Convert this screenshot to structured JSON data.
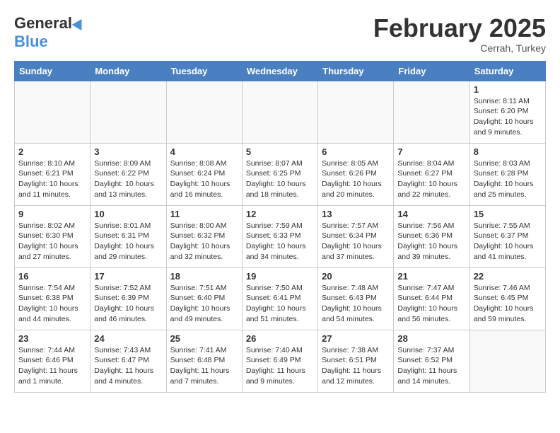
{
  "header": {
    "logo_general": "General",
    "logo_blue": "Blue",
    "month_title": "February 2025",
    "subtitle": "Cerrah, Turkey"
  },
  "weekdays": [
    "Sunday",
    "Monday",
    "Tuesday",
    "Wednesday",
    "Thursday",
    "Friday",
    "Saturday"
  ],
  "weeks": [
    [
      {
        "day": "",
        "info": ""
      },
      {
        "day": "",
        "info": ""
      },
      {
        "day": "",
        "info": ""
      },
      {
        "day": "",
        "info": ""
      },
      {
        "day": "",
        "info": ""
      },
      {
        "day": "",
        "info": ""
      },
      {
        "day": "1",
        "info": "Sunrise: 8:11 AM\nSunset: 6:20 PM\nDaylight: 10 hours\nand 9 minutes."
      }
    ],
    [
      {
        "day": "2",
        "info": "Sunrise: 8:10 AM\nSunset: 6:21 PM\nDaylight: 10 hours\nand 11 minutes."
      },
      {
        "day": "3",
        "info": "Sunrise: 8:09 AM\nSunset: 6:22 PM\nDaylight: 10 hours\nand 13 minutes."
      },
      {
        "day": "4",
        "info": "Sunrise: 8:08 AM\nSunset: 6:24 PM\nDaylight: 10 hours\nand 16 minutes."
      },
      {
        "day": "5",
        "info": "Sunrise: 8:07 AM\nSunset: 6:25 PM\nDaylight: 10 hours\nand 18 minutes."
      },
      {
        "day": "6",
        "info": "Sunrise: 8:05 AM\nSunset: 6:26 PM\nDaylight: 10 hours\nand 20 minutes."
      },
      {
        "day": "7",
        "info": "Sunrise: 8:04 AM\nSunset: 6:27 PM\nDaylight: 10 hours\nand 22 minutes."
      },
      {
        "day": "8",
        "info": "Sunrise: 8:03 AM\nSunset: 6:28 PM\nDaylight: 10 hours\nand 25 minutes."
      }
    ],
    [
      {
        "day": "9",
        "info": "Sunrise: 8:02 AM\nSunset: 6:30 PM\nDaylight: 10 hours\nand 27 minutes."
      },
      {
        "day": "10",
        "info": "Sunrise: 8:01 AM\nSunset: 6:31 PM\nDaylight: 10 hours\nand 29 minutes."
      },
      {
        "day": "11",
        "info": "Sunrise: 8:00 AM\nSunset: 6:32 PM\nDaylight: 10 hours\nand 32 minutes."
      },
      {
        "day": "12",
        "info": "Sunrise: 7:59 AM\nSunset: 6:33 PM\nDaylight: 10 hours\nand 34 minutes."
      },
      {
        "day": "13",
        "info": "Sunrise: 7:57 AM\nSunset: 6:34 PM\nDaylight: 10 hours\nand 37 minutes."
      },
      {
        "day": "14",
        "info": "Sunrise: 7:56 AM\nSunset: 6:36 PM\nDaylight: 10 hours\nand 39 minutes."
      },
      {
        "day": "15",
        "info": "Sunrise: 7:55 AM\nSunset: 6:37 PM\nDaylight: 10 hours\nand 41 minutes."
      }
    ],
    [
      {
        "day": "16",
        "info": "Sunrise: 7:54 AM\nSunset: 6:38 PM\nDaylight: 10 hours\nand 44 minutes."
      },
      {
        "day": "17",
        "info": "Sunrise: 7:52 AM\nSunset: 6:39 PM\nDaylight: 10 hours\nand 46 minutes."
      },
      {
        "day": "18",
        "info": "Sunrise: 7:51 AM\nSunset: 6:40 PM\nDaylight: 10 hours\nand 49 minutes."
      },
      {
        "day": "19",
        "info": "Sunrise: 7:50 AM\nSunset: 6:41 PM\nDaylight: 10 hours\nand 51 minutes."
      },
      {
        "day": "20",
        "info": "Sunrise: 7:48 AM\nSunset: 6:43 PM\nDaylight: 10 hours\nand 54 minutes."
      },
      {
        "day": "21",
        "info": "Sunrise: 7:47 AM\nSunset: 6:44 PM\nDaylight: 10 hours\nand 56 minutes."
      },
      {
        "day": "22",
        "info": "Sunrise: 7:46 AM\nSunset: 6:45 PM\nDaylight: 10 hours\nand 59 minutes."
      }
    ],
    [
      {
        "day": "23",
        "info": "Sunrise: 7:44 AM\nSunset: 6:46 PM\nDaylight: 11 hours\nand 1 minute."
      },
      {
        "day": "24",
        "info": "Sunrise: 7:43 AM\nSunset: 6:47 PM\nDaylight: 11 hours\nand 4 minutes."
      },
      {
        "day": "25",
        "info": "Sunrise: 7:41 AM\nSunset: 6:48 PM\nDaylight: 11 hours\nand 7 minutes."
      },
      {
        "day": "26",
        "info": "Sunrise: 7:40 AM\nSunset: 6:49 PM\nDaylight: 11 hours\nand 9 minutes."
      },
      {
        "day": "27",
        "info": "Sunrise: 7:38 AM\nSunset: 6:51 PM\nDaylight: 11 hours\nand 12 minutes."
      },
      {
        "day": "28",
        "info": "Sunrise: 7:37 AM\nSunset: 6:52 PM\nDaylight: 11 hours\nand 14 minutes."
      },
      {
        "day": "",
        "info": ""
      }
    ]
  ]
}
